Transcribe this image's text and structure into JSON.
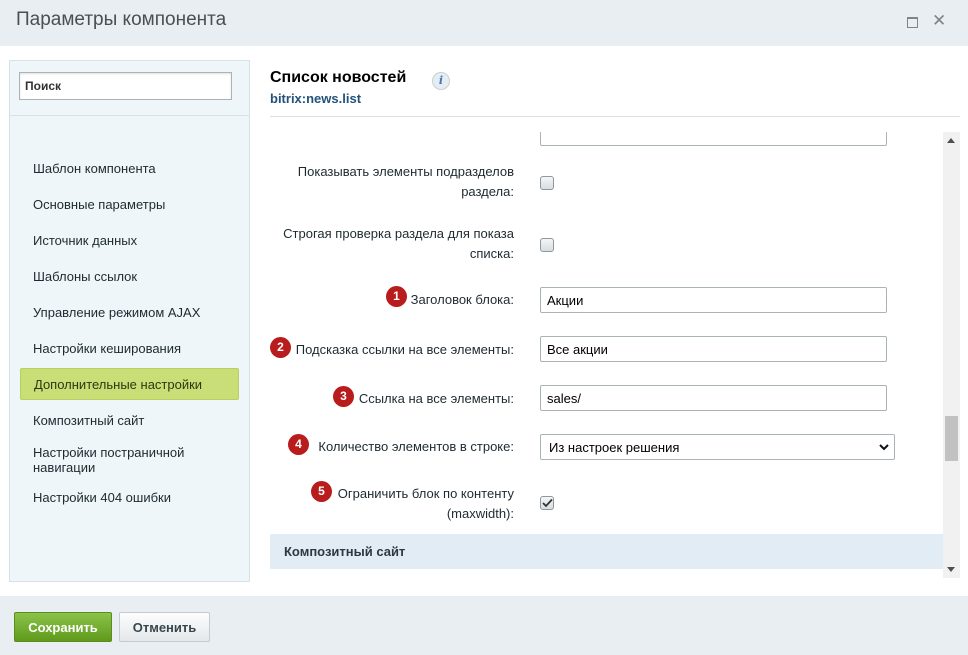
{
  "window": {
    "title": "Параметры компонента"
  },
  "sidebar": {
    "search_placeholder": "Поиск",
    "items": [
      {
        "label": "Шаблон компонента"
      },
      {
        "label": "Основные параметры"
      },
      {
        "label": "Источник данных"
      },
      {
        "label": "Шаблоны ссылок"
      },
      {
        "label": "Управление режимом AJAX"
      },
      {
        "label": "Настройки кеширования"
      },
      {
        "label": "Дополнительные настройки",
        "active": true
      },
      {
        "label": "Композитный сайт"
      },
      {
        "label": "Настройки постраничной навигации"
      },
      {
        "label": "Настройки 404 ошибки"
      }
    ]
  },
  "main": {
    "title": "Список новостей",
    "subtitle": "bitrix:news.list",
    "fields": [
      {
        "label": "Показывать элементы подразделов раздела:",
        "type": "checkbox",
        "checked": false
      },
      {
        "label": "Строгая проверка раздела для показа списка:",
        "type": "checkbox",
        "checked": false
      },
      {
        "badge": "1",
        "label": "Заголовок блока:",
        "type": "text",
        "value": "Акции"
      },
      {
        "badge": "2",
        "label": "Подсказка ссылки на все элементы:",
        "type": "text",
        "value": "Все акции"
      },
      {
        "badge": "3",
        "label": "Ссылка на все элементы:",
        "type": "text",
        "value": "sales/"
      },
      {
        "badge": "4",
        "label": "Количество элементов в строке:",
        "type": "select",
        "value": "Из настроек решения"
      },
      {
        "badge": "5",
        "label": "Ограничить блок по контенту (maxwidth):",
        "type": "checkbox",
        "checked": true
      }
    ],
    "section_header": "Композитный сайт"
  },
  "footer": {
    "save_label": "Сохранить",
    "cancel_label": "Отменить"
  },
  "colors": {
    "active_item_bg": "#c9de77",
    "save_button": "#6aa526",
    "badge": "#b81c1c",
    "subtitle": "#22527a"
  }
}
